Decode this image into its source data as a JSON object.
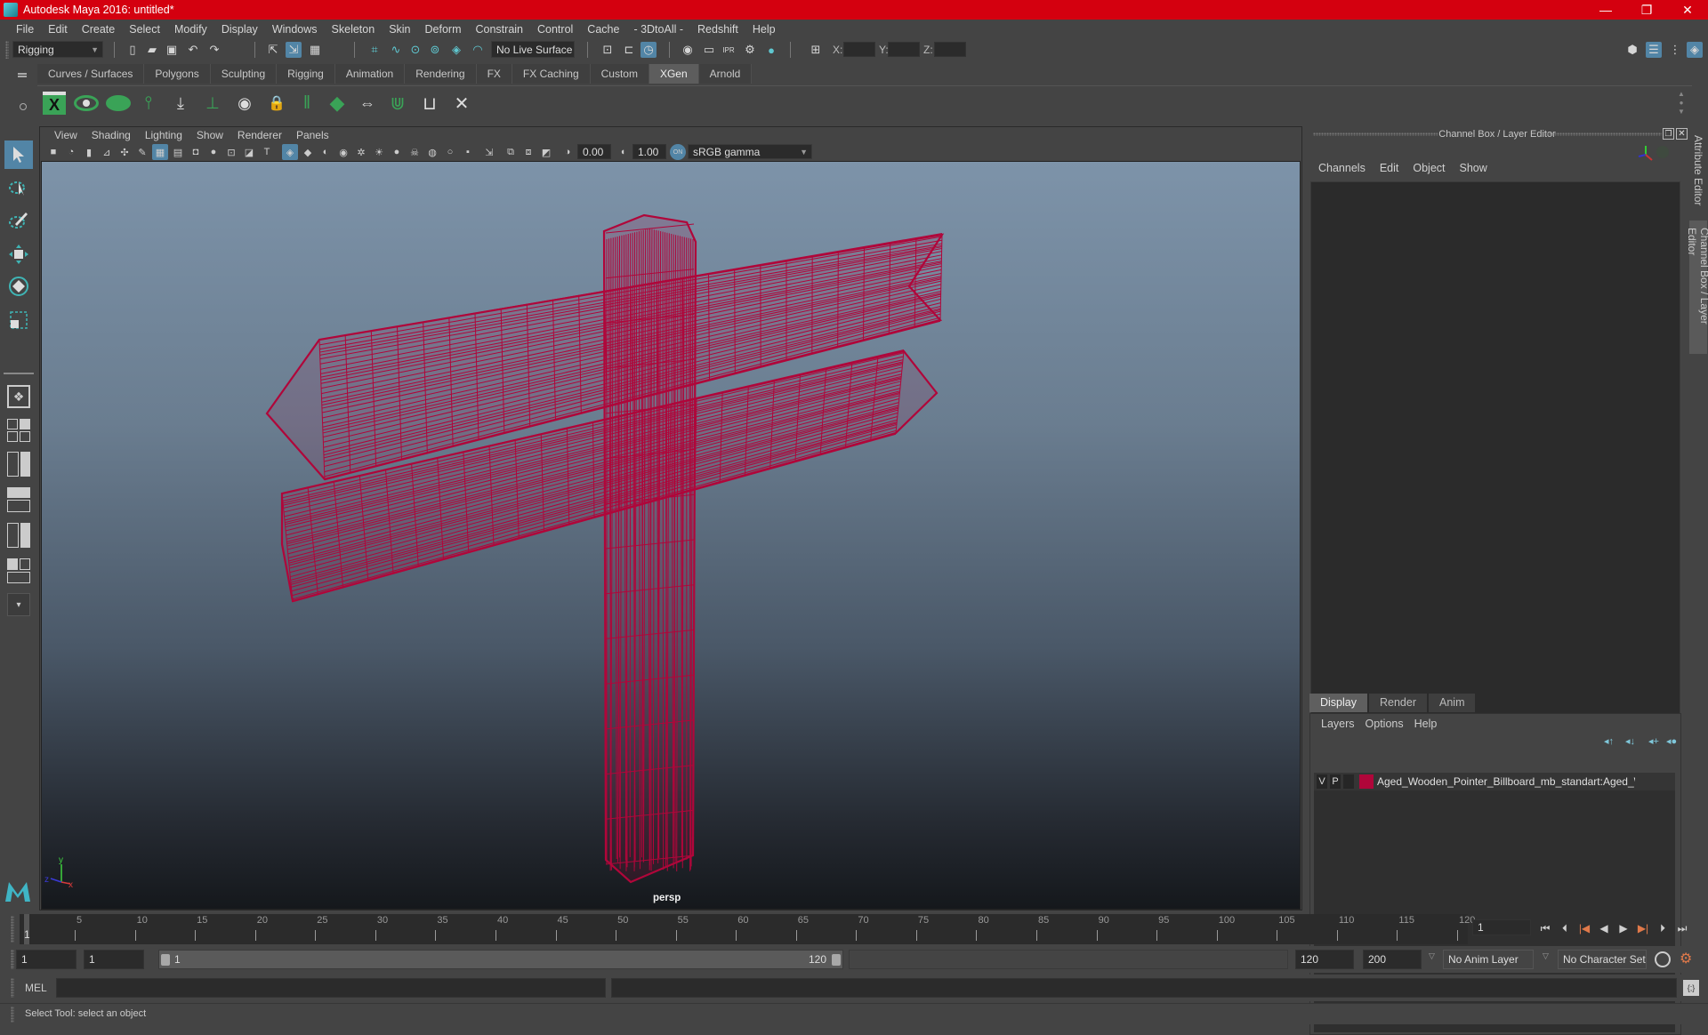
{
  "window": {
    "title": "Autodesk Maya 2016: untitled*",
    "controls": {
      "minimize": "—",
      "maximize": "❐",
      "close": "✕"
    }
  },
  "menubar": [
    "File",
    "Edit",
    "Create",
    "Select",
    "Modify",
    "Display",
    "Windows",
    "Skeleton",
    "Skin",
    "Deform",
    "Constrain",
    "Control",
    "Cache",
    "- 3DtoAll -",
    "Redshift",
    "Help"
  ],
  "statusline": {
    "menuset": "Rigging",
    "live_surface": "No Live Surface",
    "xyz_labels": {
      "x": "X:",
      "y": "Y:",
      "z": "Z:"
    },
    "xyz_values": {
      "x": "",
      "y": "",
      "z": ""
    }
  },
  "shelf": {
    "tabs": [
      "Curves / Surfaces",
      "Polygons",
      "Sculpting",
      "Rigging",
      "Animation",
      "Rendering",
      "FX",
      "FX Caching",
      "Custom",
      "XGen",
      "Arnold"
    ],
    "active_tab": "XGen",
    "icons": [
      "xgen-window-icon",
      "xgen-preview-icon",
      "xgen-hide-icon",
      "create-description-icon",
      "import-collection-icon",
      "add-guide-icon",
      "show-guides-icon",
      "lock-guides-icon",
      "guide-length-icon",
      "paint-region-icon",
      "sculpt-guides-icon",
      "select-guides-icon",
      "clump-guides-icon",
      "delete-guides-icon"
    ]
  },
  "viewport": {
    "menu": [
      "View",
      "Shading",
      "Lighting",
      "Show",
      "Renderer",
      "Panels"
    ],
    "exposure": "0.00",
    "gamma": "1.00",
    "color_space": "sRGB gamma",
    "camera": "persp",
    "axis": {
      "x": "x",
      "y": "y",
      "z": "z"
    },
    "wire_color": "#b0063a"
  },
  "channel_box": {
    "title": "Channel Box / Layer Editor",
    "menu": [
      "Channels",
      "Edit",
      "Object",
      "Show"
    ]
  },
  "layer_editor": {
    "tabs": [
      "Display",
      "Render",
      "Anim"
    ],
    "active_tab": "Display",
    "menu": [
      "Layers",
      "Options",
      "Help"
    ],
    "layers": [
      {
        "visible": "V",
        "playback": "P",
        "color": "#b0063a",
        "name": "Aged_Wooden_Pointer_Billboard_mb_standart:Aged_Wooden_Pointer_Billboard"
      }
    ]
  },
  "side_tabs": [
    "Attribute Editor",
    "Channel Box / Layer Editor"
  ],
  "timeline": {
    "start": 1,
    "end": 120,
    "current_frame": "1",
    "ticks": [
      5,
      10,
      15,
      20,
      25,
      30,
      35,
      40,
      45,
      50,
      55,
      60,
      65,
      70,
      75,
      80,
      85,
      90,
      95,
      100,
      105,
      110,
      115,
      120
    ],
    "current_label": "1"
  },
  "range": {
    "start_time": "1",
    "playback_start": "1",
    "slider_start": "1",
    "slider_end": "120",
    "playback_end": "120",
    "end_time": "200",
    "anim_layer": "No Anim Layer",
    "character_set": "No Character Set"
  },
  "command_line": {
    "label": "MEL",
    "value": ""
  },
  "help_line": "Select Tool: select an object"
}
